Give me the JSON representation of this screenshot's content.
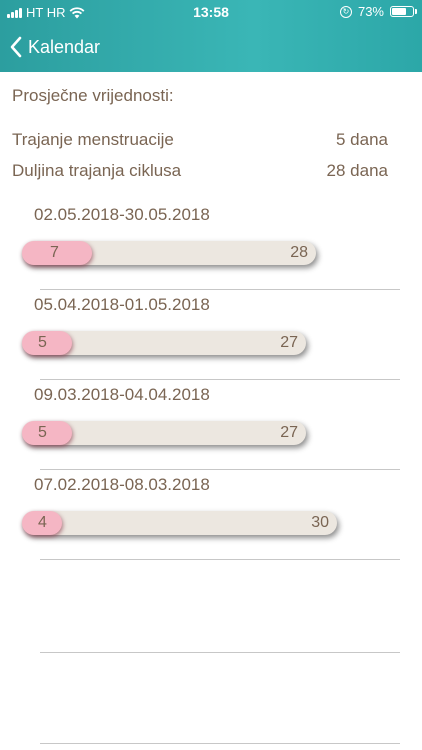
{
  "status_bar": {
    "carrier": "HT HR",
    "time": "13:58",
    "battery_percent": "73%",
    "battery_level": 0.73
  },
  "nav": {
    "back_label": "Kalendar"
  },
  "averages": {
    "title": "Prosječne vrijednosti:",
    "rows": [
      {
        "label": "Trajanje menstruacije",
        "value": "5 dana"
      },
      {
        "label": "Duljina trajanja ciklusa",
        "value": "28 dana"
      }
    ]
  },
  "cycles": [
    {
      "date_range": "02.05.2018-30.05.2018",
      "period_days": "7",
      "cycle_days": "28"
    },
    {
      "date_range": "05.04.2018-01.05.2018",
      "period_days": "5",
      "cycle_days": "27"
    },
    {
      "date_range": "09.03.2018-04.04.2018",
      "period_days": "5",
      "cycle_days": "27"
    },
    {
      "date_range": "07.02.2018-08.03.2018",
      "period_days": "4",
      "cycle_days": "30"
    }
  ],
  "colors": {
    "header": "#34aeae",
    "text": "#7a6553",
    "period_bar": "#f5b6c4",
    "cycle_bar": "#ece7e0"
  }
}
